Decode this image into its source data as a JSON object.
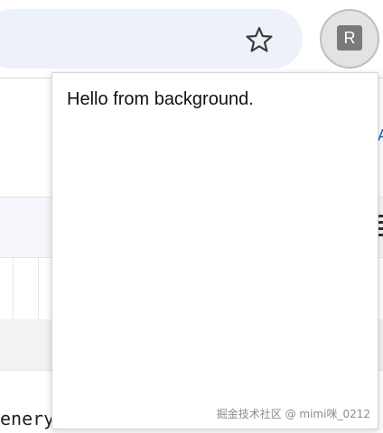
{
  "toolbar": {
    "bookmark_icon": "star-outline-icon",
    "extension_icon_letter": "R"
  },
  "background_page": {
    "bottom_code_fragment": "enery",
    "right_edge_link_fragment": "A"
  },
  "popup": {
    "message": "Hello from background."
  },
  "watermark": {
    "text": "掘金技术社区 @ mimi咪_0212"
  },
  "colors": {
    "omnibox_bg": "#edf1f9",
    "extension_tile": "#7a7a7a",
    "link_blue": "#1a5fc8"
  }
}
